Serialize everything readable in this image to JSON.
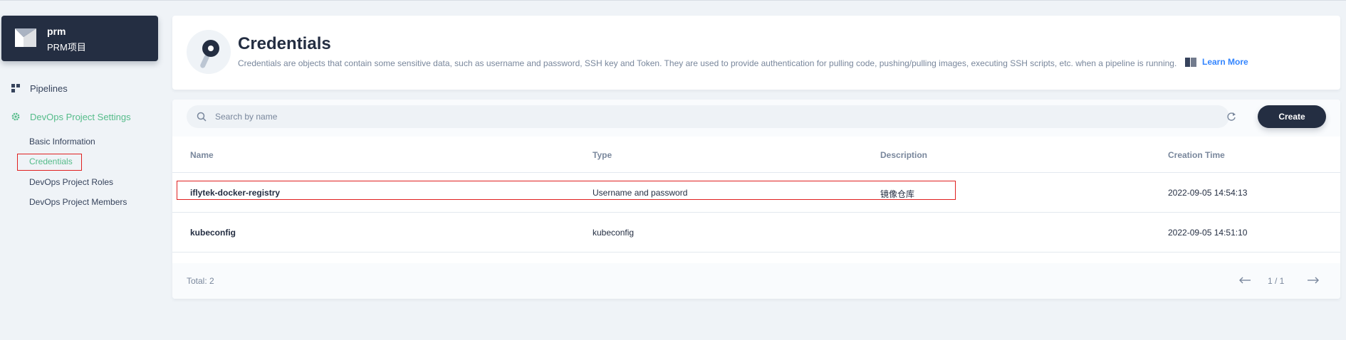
{
  "project": {
    "name": "prm",
    "description": "PRM项目"
  },
  "sidebar": {
    "items": [
      {
        "label": "Pipelines",
        "icon": "grid-icon"
      },
      {
        "label": "DevOps Project Settings",
        "icon": "gear-icon",
        "active": true
      }
    ],
    "settings_children": [
      {
        "label": "Basic Information"
      },
      {
        "label": "Credentials",
        "active": true
      },
      {
        "label": "DevOps Project Roles"
      },
      {
        "label": "DevOps Project Members"
      }
    ]
  },
  "banner": {
    "title": "Credentials",
    "description": "Credentials are objects that contain some sensitive data, such as username and password, SSH key and Token. They are used to provide authentication for pulling code, pushing/pulling images, executing SSH scripts, etc. when a pipeline is running.",
    "learn_more": "Learn More",
    "icon": "key-icon"
  },
  "toolbar": {
    "search_placeholder": "Search by name",
    "create_label": "Create"
  },
  "table": {
    "columns": [
      "Name",
      "Type",
      "Description",
      "Creation Time"
    ],
    "rows": [
      {
        "name": "iflytek-docker-registry",
        "type": "Username and password",
        "description": "镜像仓库",
        "created": "2022-09-05 14:54:13"
      },
      {
        "name": "kubeconfig",
        "type": "kubeconfig",
        "description": "",
        "created": "2022-09-05 14:51:10"
      }
    ]
  },
  "footer": {
    "total": "Total: 2",
    "page": "1 / 1"
  },
  "colors": {
    "accent": "#55bc8a",
    "dark": "#242e42",
    "link": "#3385ff",
    "highlight": "#e02020"
  }
}
